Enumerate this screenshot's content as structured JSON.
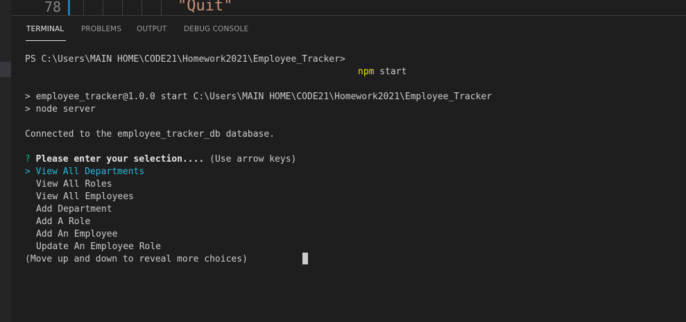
{
  "editor": {
    "line_number": "78",
    "code_text": "\"Quit\""
  },
  "panel": {
    "tabs": [
      {
        "label": "TERMINAL",
        "active": true
      },
      {
        "label": "PROBLEMS",
        "active": false
      },
      {
        "label": "OUTPUT",
        "active": false
      },
      {
        "label": "DEBUG CONSOLE",
        "active": false
      }
    ]
  },
  "terminal": {
    "prompt": "PS C:\\Users\\MAIN HOME\\CODE21\\Homework2021\\Employee_Tracker>",
    "command": "npm",
    "command_args": " start",
    "npm_line1": "> employee_tracker@1.0.0 start C:\\Users\\MAIN HOME\\CODE21\\Homework2021\\Employee_Tracker",
    "npm_line2": "> node server",
    "connected": "Connected to the employee_tracker_db database.",
    "question_mark": "?",
    "question": "Please enter your selection....",
    "hint": " (Use arrow keys)",
    "selected_pointer": ">",
    "choices": [
      "View All Departments",
      "View All Roles",
      "View All Employees",
      "Add Department",
      "Add A Role",
      "Add An Employee",
      "Update An Employee Role"
    ],
    "more_choices": "(Move up and down to reveal more choices)"
  },
  "colors": {
    "background": "#1e1e1e",
    "command_highlight": "#e5e510",
    "selected_choice": "#29b8db",
    "question_mark": "#0dbc79"
  }
}
